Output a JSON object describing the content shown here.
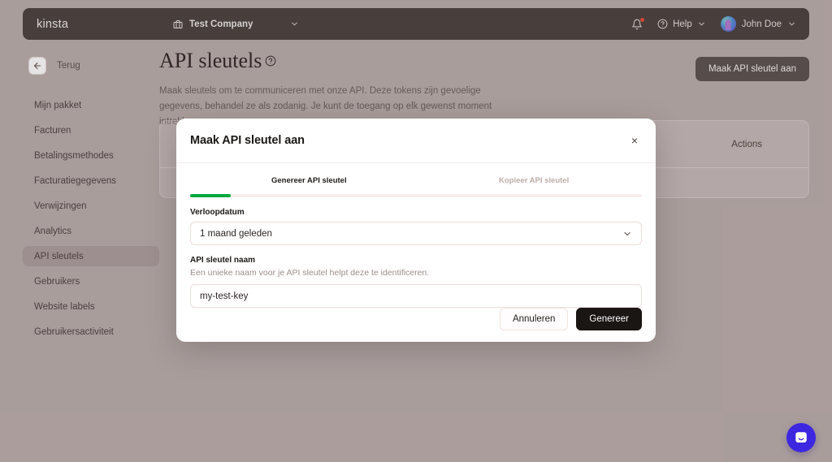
{
  "topbar": {
    "logo": "kinsta",
    "company": "Test Company",
    "company_chevron_icon": "chevron-down-icon",
    "briefcase_icon": "briefcase-icon",
    "bell_icon": "bell-icon",
    "help_label": "Help",
    "help_icon": "question-circle-icon",
    "help_chevron_icon": "chevron-down-icon",
    "user_name": "John Doe",
    "user_chevron_icon": "chevron-down-icon",
    "bg_color": "#4a403e"
  },
  "sidebar": {
    "back_label": "Terug",
    "back_icon": "arrow-left-icon",
    "items": [
      {
        "label": "Mijn pakket",
        "active": false
      },
      {
        "label": "Facturen",
        "active": false
      },
      {
        "label": "Betalingsmethodes",
        "active": false
      },
      {
        "label": "Facturatiegegevens",
        "active": false
      },
      {
        "label": "Verwijzingen",
        "active": false
      },
      {
        "label": "Analytics",
        "active": false
      },
      {
        "label": "API sleutels",
        "active": true
      },
      {
        "label": "Gebruikers",
        "active": false
      },
      {
        "label": "Website labels",
        "active": false
      },
      {
        "label": "Gebruikersactiviteit",
        "active": false
      }
    ]
  },
  "page": {
    "title": "API sleutels",
    "title_help_icon": "question-circle-icon",
    "description": "Maak sleutels om te communiceren met onze API. Deze tokens zijn gevoelige gegevens, behandel ze als zodanig. Je kunt de toegang op elk gewenst moment intrekken.",
    "create_button": "Maak API sleutel aan"
  },
  "background_card": {
    "actions_header": "Actions"
  },
  "modal": {
    "title": "Maak API sleutel aan",
    "close_icon": "close-icon",
    "close_label": "×",
    "steps": [
      {
        "label": "Genereer API sleutel",
        "active": true
      },
      {
        "label": "Kopieer API sleutel",
        "active": false
      }
    ],
    "progress": {
      "percent": 9,
      "fill_color": "#00a83e",
      "track_color": "#f7eeec"
    },
    "expiry": {
      "label": "Verloopdatum",
      "value": "1 maand geleden",
      "chevron_icon": "chevron-down-icon"
    },
    "name": {
      "label": "API sleutel naam",
      "hint": "Een unieke naam voor je API sleutel helpt deze te identificeren.",
      "value": "my-test-key",
      "placeholder": "my-test-key"
    },
    "cancel_button": "Annuleren",
    "submit_button": "Genereer"
  },
  "chat": {
    "icon": "chat-bubble-icon",
    "color": "#3d27e0"
  }
}
